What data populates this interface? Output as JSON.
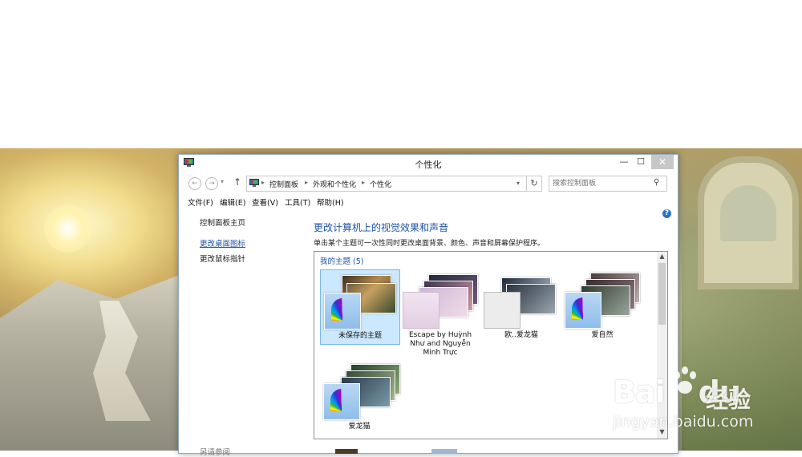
{
  "window": {
    "title": "个性化",
    "controls": {
      "minimize": "—",
      "maximize": "☐",
      "close": "✕"
    }
  },
  "address": {
    "crumbs": [
      "控制面板",
      "外观和个性化",
      "个性化"
    ],
    "search_placeholder": "搜索控制面板"
  },
  "menu": [
    "文件(F)",
    "编辑(E)",
    "查看(V)",
    "工具(T)",
    "帮助(H)"
  ],
  "left_nav": {
    "home": "控制面板主页",
    "links": [
      "更改桌面图标",
      "更改鼠标指针"
    ],
    "see_also": "另请参阅"
  },
  "main": {
    "title": "更改计算机上的视觉效果和声音",
    "description": "单击某个主题可一次性同时更改桌面背景、颜色、声音和屏幕保护程序。",
    "group_label": "我的主题",
    "group_count": "(5)"
  },
  "themes": [
    {
      "label": "未保存的主题",
      "selected": true
    },
    {
      "label": "Escape by Huỳnh Như and Nguyễn Minh Trực",
      "selected": false
    },
    {
      "label": "欧..爱龙猫",
      "selected": false
    },
    {
      "label": "爱自然",
      "selected": false
    },
    {
      "label": "爱龙猫",
      "selected": false
    }
  ],
  "watermark": {
    "brand": "Bai",
    "brand2": "du",
    "product": "经验",
    "url": "jingyan.baidu.com"
  },
  "colors": {
    "link": "#1d52a8",
    "selection": "#cce8ff",
    "help": "#2a74c9"
  }
}
